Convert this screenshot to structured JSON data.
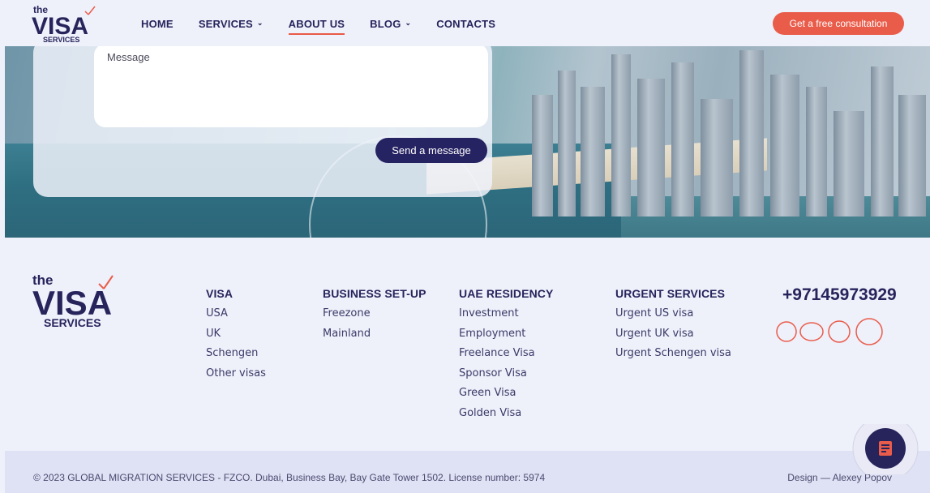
{
  "brand": {
    "logo_the": "the",
    "logo_visa": "VISA",
    "logo_services": "SERVICES",
    "accent": "#ea5c4a",
    "navy": "#27245c"
  },
  "nav": {
    "items": [
      {
        "label": "HOME",
        "has_dropdown": false,
        "active": false
      },
      {
        "label": "SERVICES",
        "has_dropdown": true,
        "active": false
      },
      {
        "label": "ABOUT US",
        "has_dropdown": false,
        "active": true
      },
      {
        "label": "BLOG",
        "has_dropdown": true,
        "active": false
      },
      {
        "label": "CONTACTS",
        "has_dropdown": false,
        "active": false
      }
    ],
    "cta_label": "Get a free consultation"
  },
  "form": {
    "message_label": "Message",
    "send_label": "Send a message"
  },
  "footer": {
    "columns": [
      {
        "title": "VISA",
        "items": [
          "USA",
          "UK",
          "Schengen",
          "Other visas"
        ]
      },
      {
        "title": "BUSINESS SET-UP",
        "items": [
          "Freezone",
          "Mainland"
        ]
      },
      {
        "title": "UAE RESIDENCY",
        "items": [
          "Investment",
          "Employment",
          "Freelance Visa",
          "Sponsor Visa",
          "Green Visa",
          "Golden Visa"
        ]
      },
      {
        "title": "URGENT SERVICES",
        "items": [
          "Urgent US visa",
          "Urgent UK visa",
          "Urgent Schengen visa"
        ]
      }
    ],
    "phone": "+97145973929",
    "social_icons": [
      "social-icon-1",
      "social-icon-2",
      "social-icon-3",
      "social-icon-4"
    ],
    "copyright": "© 2023 GLOBAL MIGRATION SERVICES - FZCO. Dubai, Business Bay, Bay Gate Tower 1502. License number: 5974",
    "design_credit": "Design — Alexey Popov"
  }
}
